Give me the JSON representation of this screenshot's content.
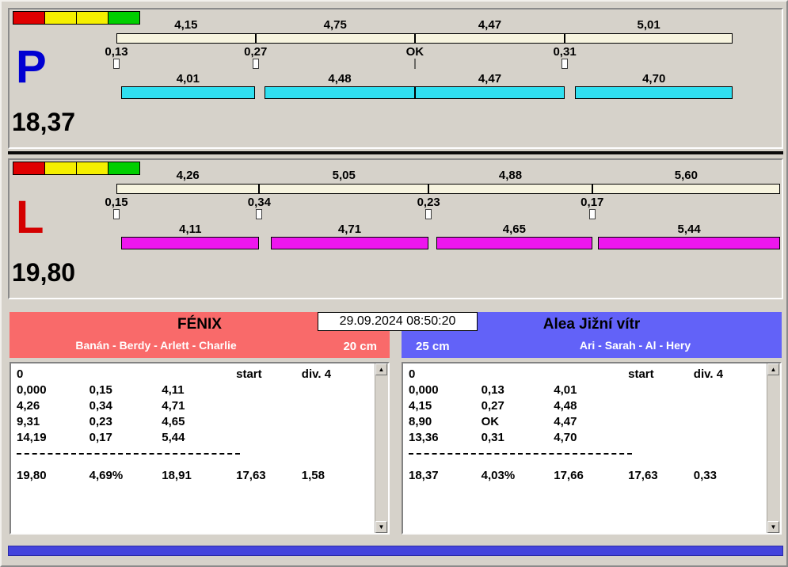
{
  "datetime": "29.09.2024 08:50:20",
  "status_lights": [
    "#e00000",
    "#f5ef00",
    "#f5ef00",
    "#00cf00"
  ],
  "icons": {
    "scroll_up": "▲",
    "scroll_down": "▼"
  },
  "colors": {
    "bottom_bar": "#4444dc"
  },
  "bars": {
    "time_scale_seconds": 19.84,
    "panels": [
      {
        "label": "P",
        "label_color": "#0000d2",
        "bar_color": "#30dff0",
        "total": "18,37",
        "splits": [
          "4,15",
          "4,75",
          "4,47",
          "5,01"
        ],
        "changes": [
          "0,13",
          "0,27",
          "OK",
          "0,31"
        ],
        "runs": [
          "4,01",
          "4,48",
          "4,47",
          "4,70"
        ]
      },
      {
        "label": "L",
        "label_color": "#d40000",
        "bar_color": "#ee16ee",
        "total": "19,80",
        "splits": [
          "4,26",
          "5,05",
          "4,88",
          "5,60"
        ],
        "changes": [
          "0,15",
          "0,34",
          "0,23",
          "0,17"
        ],
        "runs": [
          "4,11",
          "4,71",
          "4,65",
          "5,44"
        ]
      }
    ]
  },
  "teams": [
    {
      "name": "FÉNIX",
      "members": "Banán - Berdy - Arlett - Charlie",
      "jump_height": "20 cm",
      "header_color": "#f96a6a",
      "table": {
        "header": [
          "0",
          "",
          "",
          "start",
          "div. 4"
        ],
        "rows": [
          [
            "0,000",
            "0,15",
            "4,11",
            "",
            ""
          ],
          [
            "4,26",
            "0,34",
            "4,71",
            "",
            ""
          ],
          [
            "9,31",
            "0,23",
            "4,65",
            "",
            ""
          ],
          [
            "14,19",
            "0,17",
            "5,44",
            "",
            ""
          ]
        ],
        "summary": [
          "19,80",
          "4,69%",
          "18,91",
          "17,63",
          "1,58"
        ]
      }
    },
    {
      "name": "Alea Jižní vítr",
      "members": "Ari - Sarah - Al - Hery",
      "jump_height": "25 cm",
      "header_color": "#6262f8",
      "table": {
        "header": [
          "0",
          "",
          "",
          "start",
          "div. 4"
        ],
        "rows": [
          [
            "0,000",
            "0,13",
            "4,01",
            "",
            ""
          ],
          [
            "4,15",
            "0,27",
            "4,48",
            "",
            ""
          ],
          [
            "8,90",
            "OK",
            "4,47",
            "",
            ""
          ],
          [
            "13,36",
            "0,31",
            "4,70",
            "",
            ""
          ]
        ],
        "summary": [
          "18,37",
          "4,03%",
          "17,66",
          "17,63",
          "0,33"
        ]
      }
    }
  ]
}
